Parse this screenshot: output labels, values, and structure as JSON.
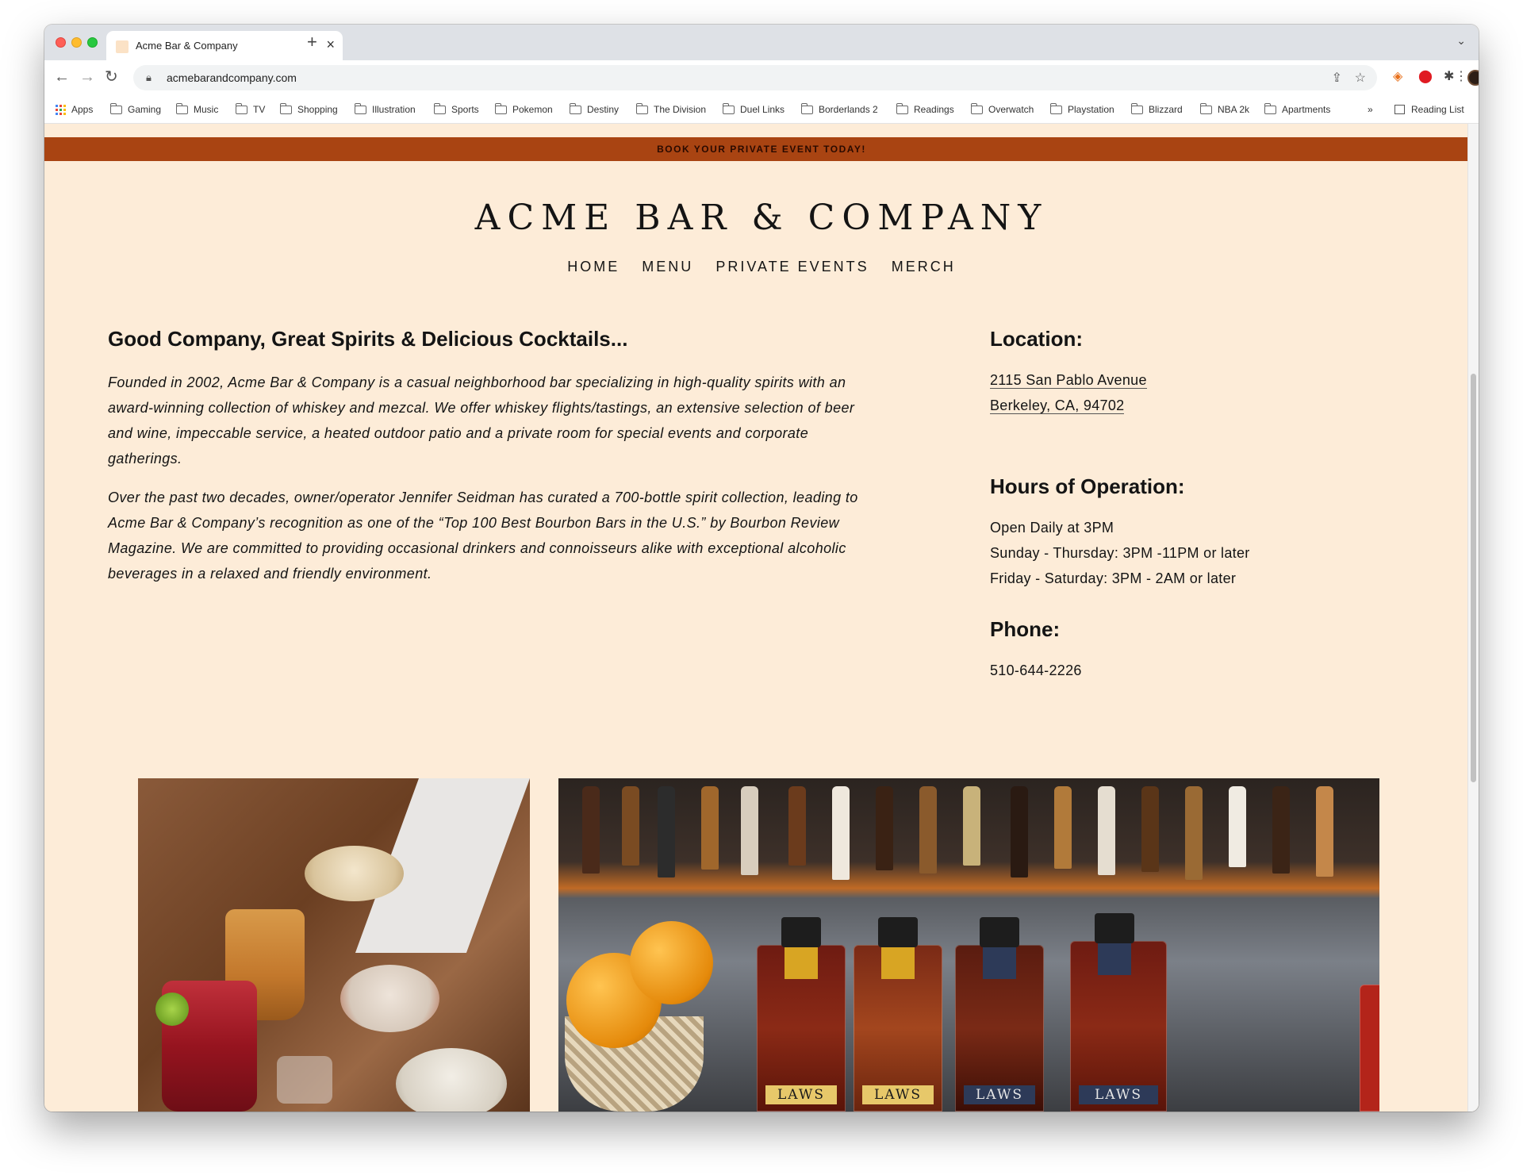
{
  "browser": {
    "tab_title": "Acme Bar & Company",
    "url": "acmebarandcompany.com",
    "bookmarks": [
      "Apps",
      "Gaming",
      "Music",
      "TV",
      "Shopping",
      "Illustration",
      "Sports",
      "Pokemon",
      "Destiny",
      "The Division",
      "Duel Links",
      "Borderlands 2",
      "Readings",
      "Overwatch",
      "Playstation",
      "Blizzard",
      "NBA 2k",
      "Apartments"
    ],
    "more_bookmarks": "»",
    "reading_list": "Reading List"
  },
  "site": {
    "announcement": "BOOK YOUR PRIVATE EVENT TODAY!",
    "title": "ACME BAR & COMPANY",
    "nav": [
      "HOME",
      "MENU",
      "PRIVATE EVENTS",
      "MERCH"
    ]
  },
  "about": {
    "heading": "Good Company, Great Spirits & Delicious Cocktails...",
    "paragraphs": [
      "Founded in 2002, Acme Bar & Company is a casual neighborhood bar specializing in high-quality spirits with an award-winning collection of whiskey and mezcal. We offer whiskey flights/tastings, an extensive selection of beer and wine, impeccable service, a heated outdoor patio and a private room for special events and corporate gatherings.",
      "Over the past two decades, owner/operator Jennifer Seidman has curated a 700-bottle spirit collection, leading to Acme Bar & Company’s recognition as one of the “Top 100 Best Bourbon Bars in the U.S.” by Bourbon Review Magazine. We are committed to providing occasional drinkers and connoisseurs alike with exceptional alcoholic beverages in a relaxed and friendly environment."
    ]
  },
  "info": {
    "location": {
      "heading": "Location:",
      "address_line1": "2115 San Pablo Avenue",
      "address_line2": "Berkeley, CA, 94702"
    },
    "hours": {
      "heading": "Hours of Operation:",
      "lines": [
        "Open Daily at 3PM",
        "Sunday - Thursday: 3PM -11PM or later",
        "Friday - Saturday: 3PM - 2AM or later"
      ]
    },
    "phone": {
      "heading": "Phone:",
      "number": "510-644-2226"
    }
  },
  "photos": {
    "bottle_label": "LAWS"
  }
}
